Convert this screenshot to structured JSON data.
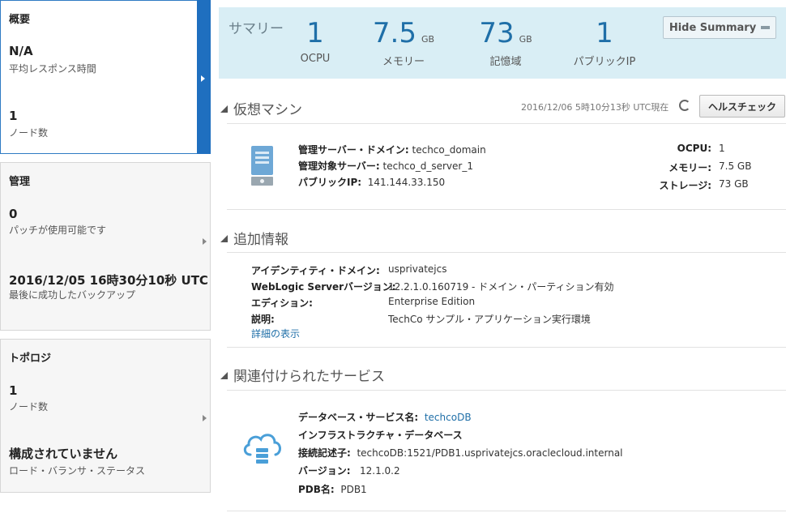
{
  "left_panels": {
    "overview": {
      "title": "概要",
      "value1": "N/A",
      "label1": "平均レスポンス時間",
      "value2": "1",
      "label2": "ノード数"
    },
    "management": {
      "title": "管理",
      "value1": "0",
      "label1": "パッチが使用可能です",
      "value2": "2016/12/05 16時30分10秒 UTC",
      "label2": "最後に成功したバックアップ"
    },
    "topology": {
      "title": "トポロジ",
      "value1": "1",
      "label1": "ノード数",
      "value2": "構成されていません",
      "label2": "ロード・バランサ・ステータス"
    }
  },
  "summary": {
    "title": "サマリー",
    "metrics": [
      {
        "value": "1",
        "unit": "",
        "label": "OCPU"
      },
      {
        "value": "7.5",
        "unit": "GB",
        "label": "メモリー"
      },
      {
        "value": "73",
        "unit": "GB",
        "label": "記憶域"
      },
      {
        "value": "1",
        "unit": "",
        "label": "パブリックIP"
      }
    ],
    "hide_button": "Hide Summary"
  },
  "vm_section": {
    "title": "仮想マシン",
    "timestamp": "2016/12/06 5時10分13秒 UTC現在",
    "health_button": "ヘルスチェック",
    "left": [
      {
        "key": "管理サーバー・ドメイン:",
        "value": "techco_domain"
      },
      {
        "key": "管理対象サーバー:",
        "value": "techco_d_server_1"
      },
      {
        "key": "パブリックIP:",
        "value": "141.144.33.150"
      }
    ],
    "right": [
      {
        "key": "OCPU:",
        "value": "1"
      },
      {
        "key": "メモリー:",
        "value": "7.5 GB"
      },
      {
        "key": "ストレージ:",
        "value": "73 GB"
      }
    ]
  },
  "additional_section": {
    "title": "追加情報",
    "rows": [
      {
        "key": "アイデンティティ・ドメイン:",
        "value": "usprivatejcs"
      },
      {
        "key": "WebLogic Serverバージョン:",
        "value": "12.2.1.0.160719 - ドメイン・パーティション有効"
      },
      {
        "key": "エディション:",
        "value": "Enterprise Edition"
      },
      {
        "key": "説明:",
        "value": "TechCo サンプル・アプリケーション実行環境"
      }
    ],
    "details_link": "詳細の表示"
  },
  "related_section": {
    "title": "関連付けられたサービス",
    "service_key": "データベース・サービス名:",
    "service_value": "techcoDB",
    "infra_label": "インフラストラクチャ・データベース",
    "rows": [
      {
        "key": "接続記述子:",
        "value": "techcoDB:1521/PDB1.usprivatejcs.oraclecloud.internal"
      },
      {
        "key": "バージョン:",
        "value": "12.1.0.2"
      },
      {
        "key": "PDB名:",
        "value": "PDB1"
      }
    ]
  },
  "colors": {
    "accent": "#1f6fbf",
    "summary_bg": "#d9eef5",
    "metric_value": "#1f6fa8"
  }
}
